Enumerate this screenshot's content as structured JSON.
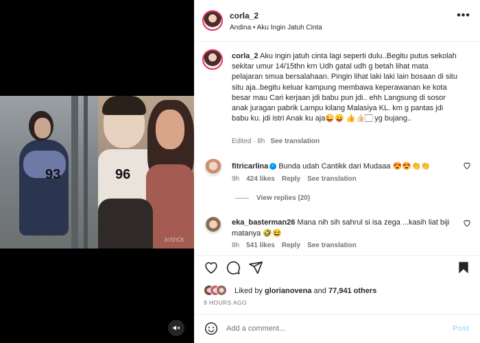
{
  "media": {
    "age_left": "93",
    "age_right": "96",
    "watermark": "InShOt"
  },
  "header": {
    "username": "corla_2",
    "subtitle": "Andina • Aku Ingin Jatuh Cinta",
    "more_label": "•••"
  },
  "caption": {
    "username": "corla_2",
    "text": "Aku ingin jatuh cinta lagi seperti dulu..Begitu putus sekolah sekitar umur 14/15thn krn Udh gatal udh g betah lihat mata pelajaran smua bersalahaan. Pingin lihat laki laki lain bosaan di situ situ aja..begitu keluar kampung membawa keperawanan ke kota besar mau Cari kerjaan jdi babu pun jdi.. ehh Langsung di sosor anak juragan pabrik Lampu kilang Malasiya KL. km g pantas jdi babu ku. jdi istri Anak ku aja😜😛 👍👍🏻🏻 yg bujang..",
    "time": "Edited · 8h",
    "see_translation": "See translation"
  },
  "comments": [
    {
      "username": "fitricarlina",
      "verified": "✓",
      "text": "Bunda udah Cantikk dari Mudaaa 😍😍👏👏",
      "time": "9h",
      "likes": "424 likes",
      "reply": "Reply",
      "see_translation": "See translation"
    },
    {
      "username": "eka_basterman26",
      "text": "Mana nih sih sahrul si isa zega ...kasih liat biji matanya 🤣😆",
      "time": "8h",
      "likes": "541 likes",
      "reply": "Reply",
      "see_translation": "See translation"
    }
  ],
  "view_replies": "View replies (20)",
  "likes": {
    "prefix": "Liked by ",
    "user": "glorianovena",
    "middle": " and ",
    "count": "77,941 others"
  },
  "time_ago": "9 HOURS AGO",
  "add_comment": {
    "placeholder": "Add a comment...",
    "post_label": "Post"
  },
  "colors": {
    "accent_blue": "#0095f6",
    "post_disabled": "#b2dffc",
    "story_ring": "#e1306c"
  },
  "icons": [
    "heart-icon",
    "comment-icon",
    "share-icon",
    "bookmark-icon",
    "emoji-icon",
    "muted-speaker-icon",
    "more-icon"
  ]
}
